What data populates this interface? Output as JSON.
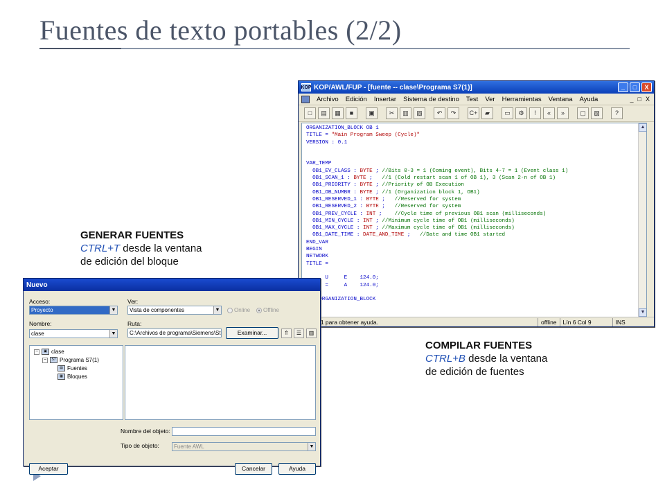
{
  "slide": {
    "title": "Fuentes de texto portables (2/2)"
  },
  "captions": {
    "generate": {
      "heading": "GENERAR FUENTES",
      "shortcut": "CTRL+T",
      "text_1": " desde la ventana",
      "text_2": "de edición del bloque"
    },
    "compile": {
      "heading": "COMPILAR FUENTES",
      "shortcut": "CTRL+B",
      "text_1": " desde la ventana",
      "text_2": "de edición de fuentes"
    }
  },
  "editor": {
    "title": "KOP/AWL/FUP  - [fuente -- clase\\Programa S7(1)]",
    "title_icon": "KOP",
    "window_buttons": {
      "minimize": "_",
      "maximize": "□",
      "close": "X"
    },
    "menu": [
      "Archivo",
      "Edición",
      "Insertar",
      "Sistema de destino",
      "Test",
      "Ver",
      "Herramientas",
      "Ventana",
      "Ayuda"
    ],
    "mdi_buttons": [
      "_",
      "□",
      "X"
    ],
    "toolbar_icons": [
      "new-icon",
      "open-icon",
      "find-icon",
      "save-icon",
      "print-icon",
      "cut-icon",
      "copy-icon",
      "paste-icon",
      "undo-icon",
      "redo-icon",
      "compile-icon",
      "download-icon",
      "block-icon",
      "monitor-icon",
      "skip-icon",
      "prev-icon",
      "next-icon",
      "view1-icon",
      "view2-icon",
      "help-icon"
    ],
    "toolbar_glyphs": [
      "□",
      "▤",
      "▦",
      "■",
      "▣",
      "✂",
      "▥",
      "▧",
      "↶",
      "↷",
      "C+",
      "▰",
      "▭",
      "⚙",
      "!",
      "«",
      "»",
      "▢",
      "▨",
      "?"
    ],
    "code_lines": [
      [
        {
          "t": "ORGANIZATION_BLOCK OB 1",
          "c": "c-blue"
        }
      ],
      [
        {
          "t": "TITLE = ",
          "c": "c-blue"
        },
        {
          "t": "\"Main Program Sweep (Cycle)\"",
          "c": "c-red"
        }
      ],
      [
        {
          "t": "VERSION : 0.1",
          "c": "c-blue"
        }
      ],
      [
        {
          "t": "",
          "c": ""
        }
      ],
      [
        {
          "t": "",
          "c": ""
        }
      ],
      [
        {
          "t": "VAR_TEMP",
          "c": "c-blue"
        }
      ],
      [
        {
          "t": "  OB1_EV_CLASS : ",
          "c": "c-blue"
        },
        {
          "t": "BYTE",
          "c": "c-red"
        },
        {
          "t": " ; ",
          "c": "c-blue"
        },
        {
          "t": "//Bits 0-3 = 1 (Coming event), Bits 4-7 = 1 (Event class 1)",
          "c": "c-green"
        }
      ],
      [
        {
          "t": "  OB1_SCAN_1 : ",
          "c": "c-blue"
        },
        {
          "t": "BYTE",
          "c": "c-red"
        },
        {
          "t": " ;   ",
          "c": "c-blue"
        },
        {
          "t": "//1 (Cold restart scan 1 of OB 1), 3 (Scan 2-n of OB 1)",
          "c": "c-green"
        }
      ],
      [
        {
          "t": "  OB1_PRIORITY : ",
          "c": "c-blue"
        },
        {
          "t": "BYTE",
          "c": "c-red"
        },
        {
          "t": " ; ",
          "c": "c-blue"
        },
        {
          "t": "//Priority of OB Execution",
          "c": "c-green"
        }
      ],
      [
        {
          "t": "  OB1_OB_NUMBR : ",
          "c": "c-blue"
        },
        {
          "t": "BYTE",
          "c": "c-red"
        },
        {
          "t": " ; ",
          "c": "c-blue"
        },
        {
          "t": "//1 (Organization block 1, OB1)",
          "c": "c-green"
        }
      ],
      [
        {
          "t": "  OB1_RESERVED_1 : ",
          "c": "c-blue"
        },
        {
          "t": "BYTE",
          "c": "c-red"
        },
        {
          "t": " ;   ",
          "c": "c-blue"
        },
        {
          "t": "//Reserved for system",
          "c": "c-green"
        }
      ],
      [
        {
          "t": "  OB1_RESERVED_2 : ",
          "c": "c-blue"
        },
        {
          "t": "BYTE",
          "c": "c-red"
        },
        {
          "t": " ;   ",
          "c": "c-blue"
        },
        {
          "t": "//Reserved for system",
          "c": "c-green"
        }
      ],
      [
        {
          "t": "  OB1_PREV_CYCLE : ",
          "c": "c-blue"
        },
        {
          "t": "INT",
          "c": "c-red"
        },
        {
          "t": " ;    ",
          "c": "c-blue"
        },
        {
          "t": "//Cycle time of previous OB1 scan (milliseconds)",
          "c": "c-green"
        }
      ],
      [
        {
          "t": "  OB1_MIN_CYCLE : ",
          "c": "c-blue"
        },
        {
          "t": "INT",
          "c": "c-red"
        },
        {
          "t": " ; ",
          "c": "c-blue"
        },
        {
          "t": "//Minimum cycle time of OB1 (milliseconds)",
          "c": "c-green"
        }
      ],
      [
        {
          "t": "  OB1_MAX_CYCLE : ",
          "c": "c-blue"
        },
        {
          "t": "INT",
          "c": "c-red"
        },
        {
          "t": " ; ",
          "c": "c-blue"
        },
        {
          "t": "//Maximum cycle time of OB1 (milliseconds)",
          "c": "c-green"
        }
      ],
      [
        {
          "t": "  OB1_DATE_TIME : ",
          "c": "c-blue"
        },
        {
          "t": "DATE_AND_TIME",
          "c": "c-red"
        },
        {
          "t": " ;   ",
          "c": "c-blue"
        },
        {
          "t": "//Date and time OB1 started",
          "c": "c-green"
        }
      ],
      [
        {
          "t": "END_VAR",
          "c": "c-blue"
        }
      ],
      [
        {
          "t": "BEGIN",
          "c": "c-blue"
        }
      ],
      [
        {
          "t": "NETWORK",
          "c": "c-blue"
        }
      ],
      [
        {
          "t": "TITLE =",
          "c": "c-blue"
        }
      ],
      [
        {
          "t": "",
          "c": ""
        }
      ],
      [
        {
          "t": "      U     E    124.0;",
          "c": "c-blue"
        }
      ],
      [
        {
          "t": "      =     A    124.0;",
          "c": "c-blue"
        }
      ],
      [
        {
          "t": "",
          "c": ""
        }
      ],
      [
        {
          "t": "END_ORGANIZATION_BLOCK",
          "c": "c-blue"
        }
      ]
    ],
    "scroll_up": "▲",
    "scroll_down": "▼",
    "status": {
      "help": "Pulse F1 para obtener ayuda.",
      "mode": "offline",
      "position": "Lín 6 Col 9",
      "insert": "INS"
    }
  },
  "dialog": {
    "title": "Nuevo",
    "acceso_label": "Acceso:",
    "acceso_value": "Proyecto",
    "ver_label": "Ver:",
    "ver_value": "Vista de componentes",
    "online_label": "Online",
    "offline_label": "Offline",
    "nombre_label": "Nombre:",
    "nombre_value": "clase",
    "ruta_label": "Ruta:",
    "ruta_value": "C:\\Archivos de programa\\Siemens\\Ste",
    "examinar_label": "Examinar...",
    "dropdown_arrow": "▼",
    "tree": {
      "expand_minus": "−",
      "root": "clase",
      "program": "Programa S7(1)",
      "fuentes": "Fuentes",
      "bloques": "Bloques"
    },
    "tree_icon_glyphs": {
      "project": "▣",
      "program": "S7",
      "fuentes": "▤",
      "bloques": "▦"
    },
    "nav_glyphs": {
      "up": "⇑",
      "list": "☰",
      "details": "▥"
    },
    "nombre_objeto_label": "Nombre del objeto:",
    "nombre_objeto_value": "",
    "tipo_objeto_label": "Tipo de objeto:",
    "tipo_objeto_value": "Fuente AWL",
    "aceptar_label": "Aceptar",
    "cancelar_label": "Cancelar",
    "ayuda_label": "Ayuda"
  }
}
